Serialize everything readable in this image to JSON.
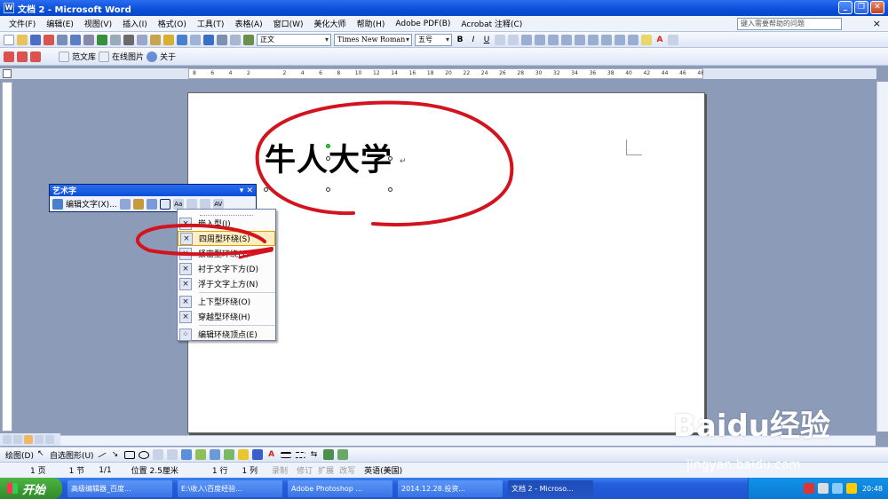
{
  "window": {
    "title": "文档 2 - Microsoft Word",
    "minimize": "_",
    "restore": "❐",
    "close": "✕"
  },
  "menu": {
    "items": [
      "文件(F)",
      "编辑(E)",
      "视图(V)",
      "插入(I)",
      "格式(O)",
      "工具(T)",
      "表格(A)",
      "窗口(W)",
      "美化大师",
      "帮助(H)",
      "Adobe PDF(B)",
      "Acrobat 注释(C)"
    ],
    "help_placeholder": "键入需要帮助的问题",
    "close_doc": "×"
  },
  "format_toolbar": {
    "style": "正文",
    "font": "Times New Roman",
    "size": "五号"
  },
  "toolbar3": {
    "templates": "范文库",
    "online_pics": "在线图片",
    "about": "关于"
  },
  "ruler_ticks": [
    "8",
    "6",
    "4",
    "2",
    "",
    "2",
    "4",
    "6",
    "8",
    "10",
    "12",
    "14",
    "16",
    "18",
    "20",
    "22",
    "24",
    "26",
    "28",
    "30",
    "32",
    "34",
    "36",
    "38",
    "40",
    "42",
    "44",
    "46",
    "48"
  ],
  "document": {
    "wordart_text": "牛人大学",
    "para_mark": "↵"
  },
  "wordart_toolbar": {
    "title": "艺术字",
    "edit_text": "编辑文字(X)..."
  },
  "wrap_menu": {
    "items": [
      {
        "label": "嵌入型(I)",
        "icon": "inline-wrap-icon"
      },
      {
        "label": "四周型环绕(S)",
        "icon": "square-wrap-icon",
        "highlighted": true
      },
      {
        "label": "紧密型环绕(T)",
        "icon": "tight-wrap-icon"
      },
      {
        "label": "衬于文字下方(D)",
        "icon": "behind-text-icon"
      },
      {
        "label": "浮于文字上方(N)",
        "icon": "in-front-text-icon"
      },
      {
        "label": "上下型环绕(O)",
        "icon": "top-bottom-wrap-icon"
      },
      {
        "label": "穿越型环绕(H)",
        "icon": "through-wrap-icon"
      },
      {
        "label": "编辑环绕顶点(E)",
        "icon": "edit-wrap-points-icon"
      }
    ]
  },
  "draw_toolbar": {
    "draw": "绘图(D)",
    "autoshapes": "自选图形(U)"
  },
  "status": {
    "page": "1 页",
    "section": "1 节",
    "pages": "1/1",
    "position": "位置 2.5厘米",
    "line": "1 行",
    "column": "1 列",
    "rec": "录制",
    "trk": "修订",
    "ext": "扩展",
    "ovr": "改写",
    "lang": "英语(美国)"
  },
  "taskbar": {
    "start": "开始",
    "tasks": [
      "高级编辑器_百度...",
      "E:\\收入\\百度经验...",
      "Adobe Photoshop ...",
      "2014.12.28.投资...",
      "文档 2 - Microso..."
    ],
    "clock": "20:48"
  },
  "watermark": {
    "brand": "Baidu经验",
    "url": "jingyan.baidu.com"
  },
  "colors": {
    "annotation": "#d2141e",
    "titlebar": "#0a4fd8",
    "highlight": "#ffeec2"
  }
}
